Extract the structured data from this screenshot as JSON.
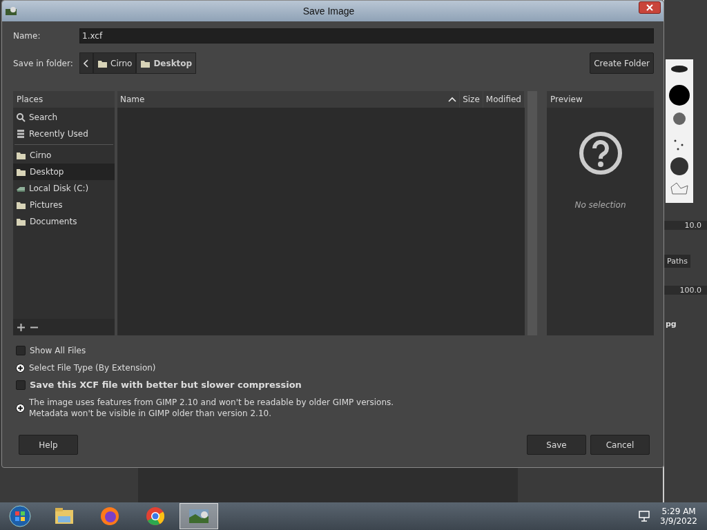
{
  "window": {
    "title": "Save Image"
  },
  "name_field": {
    "label": "Name:",
    "value": "1.xcf"
  },
  "folder": {
    "label": "Save in folder:",
    "path": [
      {
        "label": "Cirno",
        "selected": false
      },
      {
        "label": "Desktop",
        "selected": true
      }
    ],
    "create_button": "Create Folder"
  },
  "places": {
    "header": "Places",
    "sections": [
      [
        {
          "label": "Search",
          "kind": "search",
          "selected": false
        },
        {
          "label": "Recently Used",
          "kind": "recent",
          "selected": false
        }
      ],
      [
        {
          "label": "Cirno",
          "kind": "folder",
          "selected": false
        },
        {
          "label": "Desktop",
          "kind": "folder",
          "selected": true
        },
        {
          "label": "Local Disk (C:)",
          "kind": "drive",
          "selected": false
        },
        {
          "label": "Pictures",
          "kind": "folder",
          "selected": false
        },
        {
          "label": "Documents",
          "kind": "folder",
          "selected": false
        }
      ]
    ]
  },
  "file_list": {
    "columns": [
      {
        "label": "Name",
        "sorted": true
      },
      {
        "label": "Size",
        "sorted": false
      },
      {
        "label": "Modified",
        "sorted": false
      }
    ]
  },
  "preview": {
    "header": "Preview",
    "message": "No selection"
  },
  "options": [
    {
      "kind": "checkbox",
      "lines": [
        "Show All Files"
      ],
      "checked": false,
      "bold": false
    },
    {
      "kind": "expander",
      "lines": [
        "Select File Type (By Extension)"
      ],
      "expanded": false
    },
    {
      "kind": "checkbox",
      "lines": [
        "Save this XCF file with better but slower compression"
      ],
      "checked": false,
      "bold": true
    },
    {
      "kind": "expander",
      "lines": [
        "The image uses features from GIMP 2.10 and won't be readable by older GIMP versions.",
        "Metadata won't be visible in GIMP older than version 2.10."
      ],
      "expanded": false
    }
  ],
  "buttons": [
    "Help",
    "Save",
    "Cancel"
  ],
  "background_app": {
    "size_value": "10.0",
    "tab": "Paths",
    "opacity_value": "100.0",
    "layer_label": "pg"
  },
  "taskbar": {
    "apps": [
      {
        "kind": "explorer",
        "selected": false
      },
      {
        "kind": "firefox",
        "selected": false
      },
      {
        "kind": "chrome",
        "selected": false
      },
      {
        "kind": "gimp",
        "selected": true
      }
    ],
    "time": "5:29 AM",
    "date": "3/9/2022"
  }
}
